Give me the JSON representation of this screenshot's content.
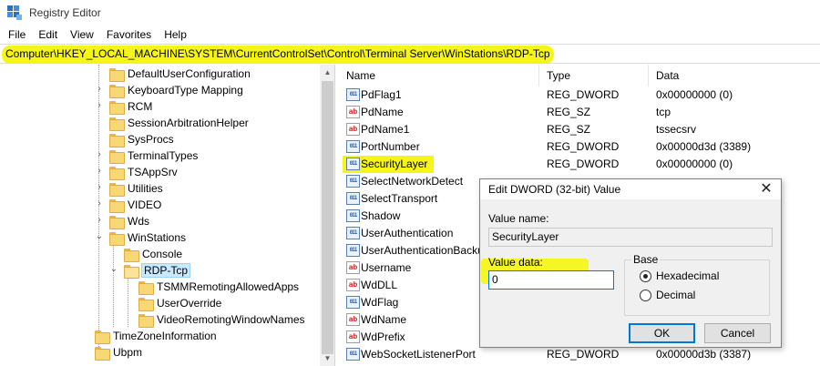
{
  "window": {
    "title": "Registry Editor",
    "icon": "registry-editor-icon"
  },
  "menu": {
    "items": [
      "File",
      "Edit",
      "View",
      "Favorites",
      "Help"
    ]
  },
  "address": {
    "path": "Computer\\HKEY_LOCAL_MACHINE\\SYSTEM\\CurrentControlSet\\Control\\Terminal Server\\WinStations\\RDP-Tcp",
    "highlight_color": "#f5f51a"
  },
  "tree": {
    "items": [
      {
        "label": "DefaultUserConfiguration",
        "expander": "",
        "selected": false
      },
      {
        "label": "KeyboardType Mapping",
        "expander": ">",
        "selected": false
      },
      {
        "label": "RCM",
        "expander": ">",
        "selected": false
      },
      {
        "label": "SessionArbitrationHelper",
        "expander": "",
        "selected": false
      },
      {
        "label": "SysProcs",
        "expander": "",
        "selected": false
      },
      {
        "label": "TerminalTypes",
        "expander": ">",
        "selected": false
      },
      {
        "label": "TSAppSrv",
        "expander": ">",
        "selected": false
      },
      {
        "label": "Utilities",
        "expander": ">",
        "selected": false
      },
      {
        "label": "VIDEO",
        "expander": ">",
        "selected": false
      },
      {
        "label": "Wds",
        "expander": ">",
        "selected": false
      },
      {
        "label": "WinStations",
        "expander": "v",
        "selected": false
      },
      {
        "label": "Console",
        "expander": "",
        "selected": false
      },
      {
        "label": "RDP-Tcp",
        "expander": "v",
        "selected": true
      },
      {
        "label": "TSMMRemotingAllowedApps",
        "expander": "",
        "selected": false
      },
      {
        "label": "UserOverride",
        "expander": "",
        "selected": false
      },
      {
        "label": "VideoRemotingWindowNames",
        "expander": "",
        "selected": false
      },
      {
        "label": "TimeZoneInformation",
        "expander": "",
        "selected": false
      },
      {
        "label": "Ubpm",
        "expander": "",
        "selected": false
      }
    ]
  },
  "list": {
    "columns": {
      "name": "Name",
      "type": "Type",
      "data": "Data"
    },
    "rows": [
      {
        "icon": "dword",
        "name": "PdFlag1",
        "type": "REG_DWORD",
        "data": "0x00000000 (0)"
      },
      {
        "icon": "sz",
        "name": "PdName",
        "type": "REG_SZ",
        "data": "tcp"
      },
      {
        "icon": "sz",
        "name": "PdName1",
        "type": "REG_SZ",
        "data": "tssecsrv"
      },
      {
        "icon": "dword",
        "name": "PortNumber",
        "type": "REG_DWORD",
        "data": "0x00000d3d (3389)"
      },
      {
        "icon": "dword",
        "name": "SecurityLayer",
        "type": "REG_DWORD",
        "data": "0x00000000 (0)"
      },
      {
        "icon": "dword",
        "name": "SelectNetworkDetect",
        "type": "",
        "data": ""
      },
      {
        "icon": "dword",
        "name": "SelectTransport",
        "type": "",
        "data": ""
      },
      {
        "icon": "dword",
        "name": "Shadow",
        "type": "",
        "data": ""
      },
      {
        "icon": "dword",
        "name": "UserAuthentication",
        "type": "",
        "data": ""
      },
      {
        "icon": "dword",
        "name": "UserAuthenticationBacku",
        "type": "",
        "data": ""
      },
      {
        "icon": "sz",
        "name": "Username",
        "type": "",
        "data": ""
      },
      {
        "icon": "sz",
        "name": "WdDLL",
        "type": "",
        "data": ""
      },
      {
        "icon": "dword",
        "name": "WdFlag",
        "type": "",
        "data": ""
      },
      {
        "icon": "sz",
        "name": "WdName",
        "type": "",
        "data": ""
      },
      {
        "icon": "sz",
        "name": "WdPrefix",
        "type": "",
        "data": ""
      },
      {
        "icon": "dword",
        "name": "WebSocketListenerPort",
        "type": "REG_DWORD",
        "data": "0x00000d3b (3387)"
      }
    ]
  },
  "dialog": {
    "title": "Edit DWORD (32-bit) Value",
    "value_name_label": "Value name:",
    "value_name": "SecurityLayer",
    "value_data_label": "Value data:",
    "value_data": "0",
    "base_label": "Base",
    "radio_hex": "Hexadecimal",
    "radio_dec": "Decimal",
    "base_selected": "Hexadecimal",
    "ok_label": "OK",
    "cancel_label": "Cancel",
    "close_glyph": "✕"
  },
  "icons": {
    "sz_glyph": "ab",
    "dword_glyph": "011"
  }
}
